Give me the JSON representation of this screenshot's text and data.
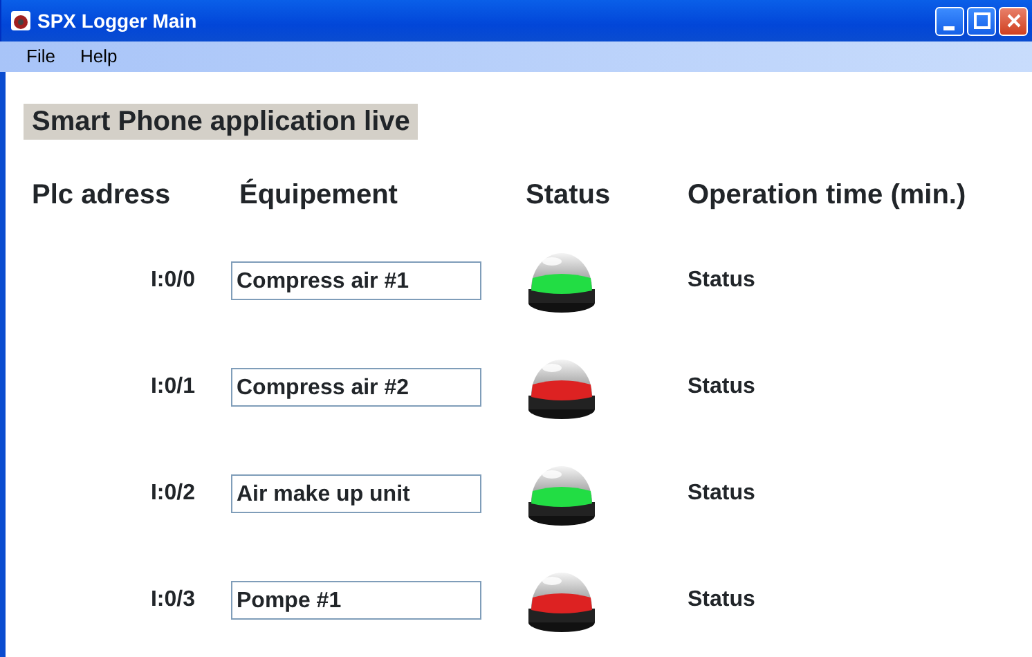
{
  "window": {
    "title": "SPX Logger Main"
  },
  "menu": [
    "File",
    "Help"
  ],
  "heading": "Smart Phone application live",
  "columns": [
    "Plc adress",
    "Équipement",
    "Status",
    "Operation time (min.)"
  ],
  "rows": [
    {
      "address": "I:0/0",
      "equipment": "Compress air #1",
      "color": "#22dd44",
      "operation": "Status"
    },
    {
      "address": "I:0/1",
      "equipment": "Compress air #2",
      "color": "#dd2222",
      "operation": "Status"
    },
    {
      "address": "I:0/2",
      "equipment": "Air make up unit",
      "color": "#22dd44",
      "operation": "Status"
    },
    {
      "address": "I:0/3",
      "equipment": "Pompe #1",
      "color": "#dd2222",
      "operation": "Status"
    }
  ]
}
